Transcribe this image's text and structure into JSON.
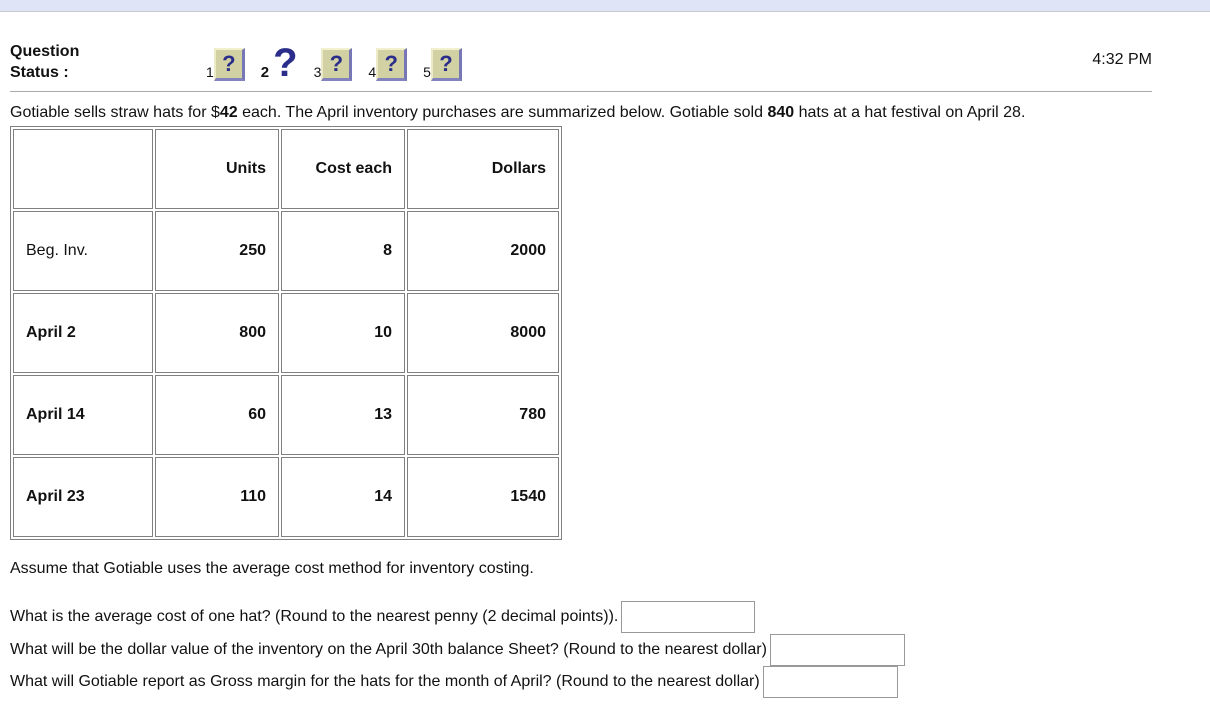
{
  "header": {
    "status_label_line1": "Question",
    "status_label_line2": "Status :",
    "time": "4:32 PM",
    "questions": [
      {
        "number": "1",
        "status": "unanswered",
        "icon": "question-mark-icon",
        "current": false
      },
      {
        "number": "2",
        "status": "current",
        "icon": "question-mark-icon",
        "current": true
      },
      {
        "number": "3",
        "status": "unanswered",
        "icon": "question-mark-icon",
        "current": false
      },
      {
        "number": "4",
        "status": "unanswered",
        "icon": "question-mark-icon",
        "current": false
      },
      {
        "number": "5",
        "status": "unanswered",
        "icon": "question-mark-icon",
        "current": false
      }
    ],
    "question_glyph": "?",
    "colors": {
      "icon_box": "#d2d1a4",
      "icon_glyph": "#2a2d8a",
      "top_bar": "#dfe4f6"
    }
  },
  "intro": {
    "part1": "Gotiable sells straw hats for $",
    "price": "42",
    "part2": " each. The April inventory purchases are summarized below. Gotiable sold ",
    "sold_qty": "840",
    "part3": " hats at a hat festival on April 28."
  },
  "table": {
    "headers": [
      "",
      "Units",
      "Cost each",
      "Dollars"
    ],
    "rows": [
      {
        "label": "Beg. Inv.",
        "units": "250",
        "cost_each": "8",
        "dollars": "2000"
      },
      {
        "label": "April 2",
        "units": "800",
        "cost_each": "10",
        "dollars": "8000"
      },
      {
        "label": "April 14",
        "units": "60",
        "cost_each": "13",
        "dollars": "780"
      },
      {
        "label": "April 23",
        "units": "110",
        "cost_each": "14",
        "dollars": "1540"
      }
    ]
  },
  "assumption": "Assume that Gotiable uses the average cost method for inventory costing.",
  "questions": [
    {
      "text": "What is the average cost of one hat? (Round to the nearest penny (2 decimal points)).",
      "value": ""
    },
    {
      "text": "What will be the dollar value of the inventory on the April 30th balance Sheet? (Round to the nearest dollar)",
      "value": ""
    },
    {
      "text": "What will Gotiable report as Gross margin for the hats for the month of April? (Round to the nearest dollar)",
      "value": ""
    }
  ]
}
